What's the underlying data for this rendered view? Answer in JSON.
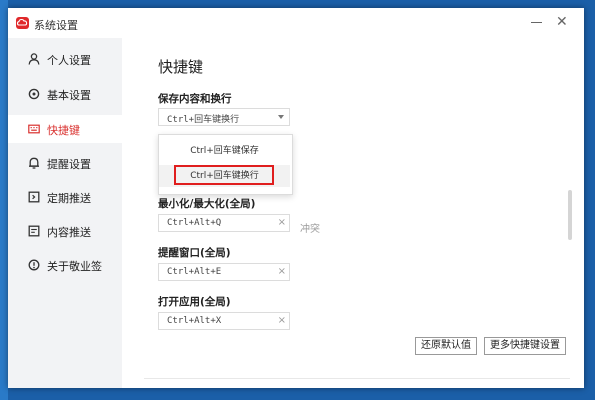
{
  "window": {
    "title": "系统设置"
  },
  "sidebar": {
    "items": [
      {
        "label": "个人设置",
        "icon": "user-icon"
      },
      {
        "label": "基本设置",
        "icon": "gear-icon"
      },
      {
        "label": "快捷键",
        "icon": "keyboard-icon",
        "active": true
      },
      {
        "label": "提醒设置",
        "icon": "bell-icon"
      },
      {
        "label": "定期推送",
        "icon": "schedule-icon"
      },
      {
        "label": "内容推送",
        "icon": "document-icon"
      },
      {
        "label": "关于敬业签",
        "icon": "info-icon"
      }
    ]
  },
  "main": {
    "title": "快捷键",
    "save_newline": {
      "label": "保存内容和换行",
      "value": "Ctrl+回车键换行",
      "options": [
        "Ctrl+回车键保存",
        "Ctrl+回车键换行"
      ],
      "highlighted_option": "Ctrl+回车键换行"
    },
    "minmax": {
      "label": "最小化/最大化(全局)",
      "value": "Ctrl+Alt+Q",
      "clear": "×",
      "status": "冲突"
    },
    "reminder": {
      "label": "提醒窗口(全局)",
      "value": "Ctrl+Alt+E",
      "clear": "×"
    },
    "open_app": {
      "label": "打开应用(全局)",
      "value": "Ctrl+Alt+X",
      "clear": "×"
    },
    "buttons": {
      "restore": "还原默认值",
      "more": "更多快捷键设置"
    }
  },
  "colors": {
    "accent": "#d9312f",
    "highlight_box": "#e01e1e",
    "sidebar_bg": "#f2f3f5"
  }
}
